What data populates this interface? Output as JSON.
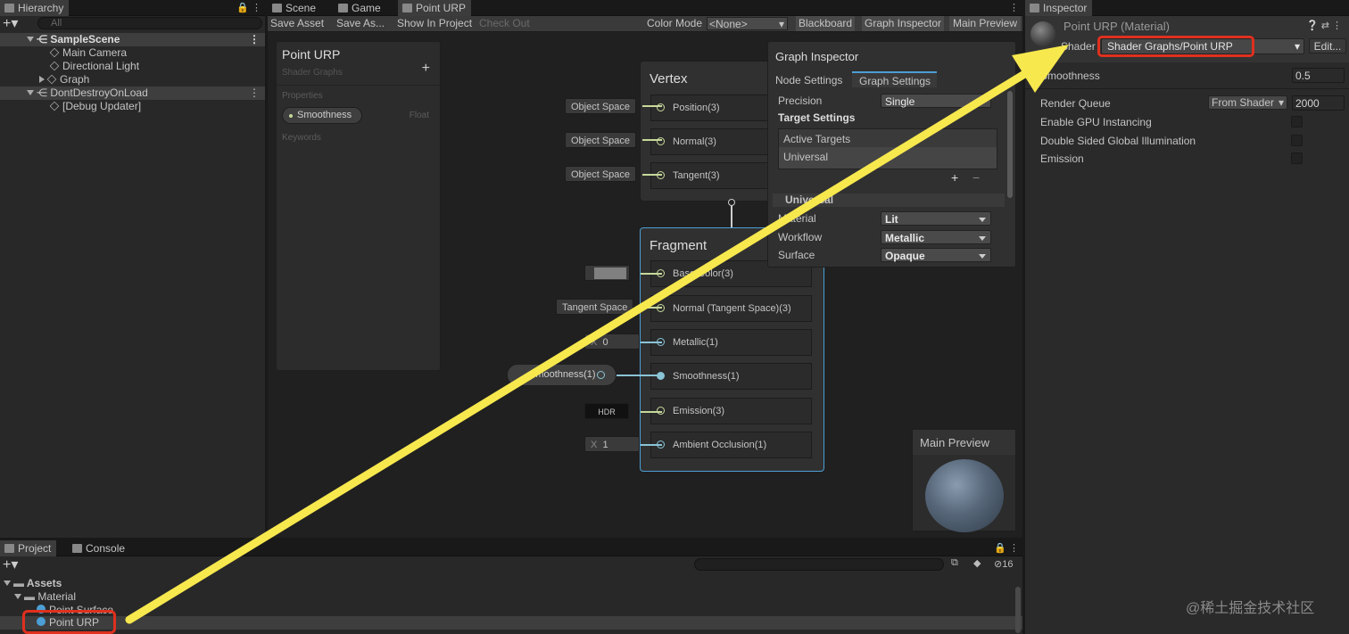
{
  "hierarchy": {
    "tab": "Hierarchy",
    "search_placeholder": "All",
    "items": [
      {
        "label": "SampleScene"
      },
      {
        "label": "Main Camera"
      },
      {
        "label": "Directional Light"
      },
      {
        "label": "Graph"
      },
      {
        "label": "DontDestroyOnLoad"
      },
      {
        "label": "[Debug Updater]"
      }
    ]
  },
  "center_tabs": {
    "scene": "Scene",
    "game": "Game",
    "shader": "Point URP"
  },
  "toolbar": {
    "save_asset": "Save Asset",
    "save_as": "Save As...",
    "show_in_project": "Show In Project",
    "check_out": "Check Out",
    "color_mode_label": "Color Mode",
    "color_mode_value": "<None>",
    "blackboard": "Blackboard",
    "graph_inspector": "Graph Inspector",
    "main_preview": "Main Preview"
  },
  "blackboard": {
    "title": "Point URP",
    "subtitle": "Shader Graphs",
    "add": "+",
    "properties_label": "Properties",
    "property_name": "Smoothness",
    "property_type": "Float",
    "keywords_label": "Keywords"
  },
  "vertex": {
    "title": "Vertex",
    "slots": [
      {
        "label": "Position(3)",
        "input": "Object Space"
      },
      {
        "label": "Normal(3)",
        "input": "Object Space"
      },
      {
        "label": "Tangent(3)",
        "input": "Object Space"
      }
    ]
  },
  "fragment": {
    "title": "Fragment",
    "slots": [
      {
        "label": "Base Color(3)",
        "input": ""
      },
      {
        "label": "Normal (Tangent Space)(3)",
        "input": "Tangent Space"
      },
      {
        "label": "Metallic(1)",
        "input": "0",
        "prefix": "X"
      },
      {
        "label": "Smoothness(1)",
        "input": "Smoothness(1)"
      },
      {
        "label": "Emission(3)",
        "input": "HDR"
      },
      {
        "label": "Ambient Occlusion(1)",
        "input": "1",
        "prefix": "X"
      }
    ]
  },
  "graph_inspector": {
    "title": "Graph Inspector",
    "tab_node": "Node Settings",
    "tab_graph": "Graph Settings",
    "precision_label": "Precision",
    "precision_value": "Single",
    "target_settings": "Target Settings",
    "active_targets": "Active Targets",
    "target_item": "Universal",
    "plus": "+",
    "minus": "−",
    "universal_section": "Universal",
    "material_label": "Material",
    "material_value": "Lit",
    "workflow_label": "Workflow",
    "workflow_value": "Metallic",
    "surface_label": "Surface",
    "surface_value": "Opaque"
  },
  "main_preview": {
    "title": "Main Preview"
  },
  "project": {
    "tab_project": "Project",
    "tab_console": "Console",
    "count": "16",
    "items": [
      {
        "label": "Assets"
      },
      {
        "label": "Material"
      },
      {
        "label": "Point Surface"
      },
      {
        "label": "Point URP"
      }
    ]
  },
  "inspector": {
    "tab": "Inspector",
    "title": "Point URP (Material)",
    "shader_label": "Shader",
    "shader_value": "Shader Graphs/Point URP",
    "edit": "Edit...",
    "smoothness_label": "Smoothness",
    "smoothness_value": "0.5",
    "render_queue_label": "Render Queue",
    "render_queue_mode": "From Shader",
    "render_queue_value": "2000",
    "gpu_instancing": "Enable GPU Instancing",
    "double_sided": "Double Sided Global Illumination",
    "emission": "Emission"
  },
  "watermark": "@稀土掘金技术社区",
  "colors": {
    "highlight": "#e0301e",
    "arrow": "#f7e84e",
    "accent": "#4b9fd5"
  }
}
